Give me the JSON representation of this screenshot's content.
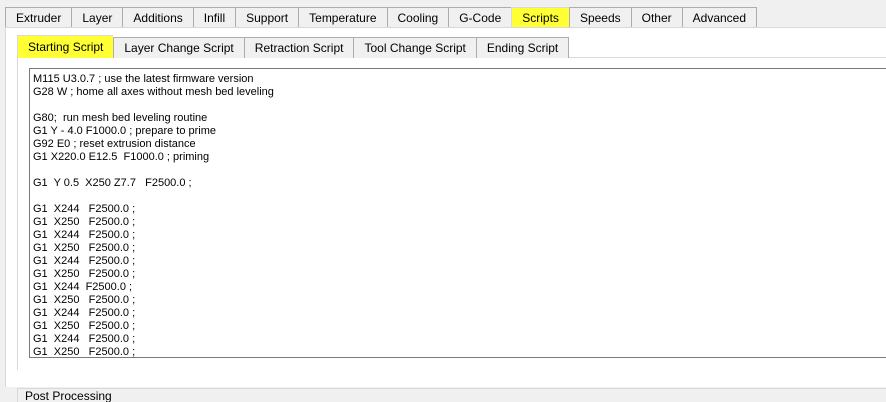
{
  "top_tabs": [
    {
      "label": "Extruder",
      "active": false
    },
    {
      "label": "Layer",
      "active": false
    },
    {
      "label": "Additions",
      "active": false
    },
    {
      "label": "Infill",
      "active": false
    },
    {
      "label": "Support",
      "active": false
    },
    {
      "label": "Temperature",
      "active": false
    },
    {
      "label": "Cooling",
      "active": false
    },
    {
      "label": "G-Code",
      "active": false
    },
    {
      "label": "Scripts",
      "active": true
    },
    {
      "label": "Speeds",
      "active": false
    },
    {
      "label": "Other",
      "active": false
    },
    {
      "label": "Advanced",
      "active": false
    }
  ],
  "script_tabs": [
    {
      "label": "Starting Script",
      "active": true
    },
    {
      "label": "Layer Change Script",
      "active": false
    },
    {
      "label": "Retraction Script",
      "active": false
    },
    {
      "label": "Tool Change Script",
      "active": false
    },
    {
      "label": "Ending Script",
      "active": false
    }
  ],
  "highlight_color": "#ffff33",
  "editor": {
    "text": "M115 U3.0.7 ; use the latest firmware version\nG28 W ; home all axes without mesh bed leveling\n\nG80;  run mesh bed leveling routine\nG1 Y - 4.0 F1000.0 ; prepare to prime\nG92 E0 ; reset extrusion distance\nG1 X220.0 E12.5  F1000.0 ; priming\n\nG1  Y 0.5  X250 Z7.7   F2500.0 ;\n\nG1  X244   F2500.0 ;\nG1  X250   F2500.0 ;\nG1  X244   F2500.0 ;\nG1  X250   F2500.0 ;\nG1  X244   F2500.0 ;\nG1  X250   F2500.0 ;\nG1  X244  F2500.0 ;\nG1  X250   F2500.0 ;\nG1  X244   F2500.0 ;\nG1  X250   F2500.0 ;\nG1  X244   F2500.0 ;\nG1  X250   F2500.0 ;"
  },
  "post_processing": {
    "label": "Post Processing"
  }
}
